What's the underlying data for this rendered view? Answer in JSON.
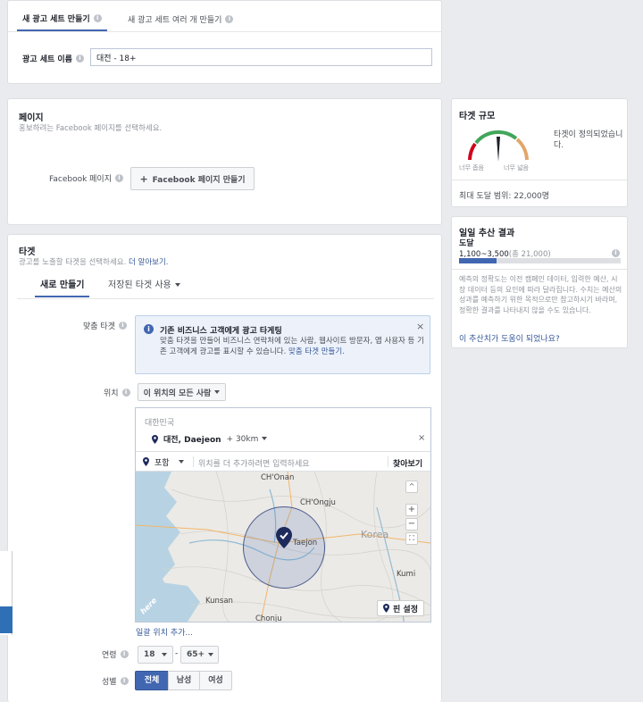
{
  "top_tabs": {
    "single": "새 광고 세트 만들기",
    "multiple": "새 광고 세트 여러 개 만들기"
  },
  "adset_name": {
    "label": "광고 세트 이름",
    "value": "대전 - 18+"
  },
  "page_section": {
    "title": "페이지",
    "subtitle": "홍보하려는 Facebook 페이지를 선택하세요.",
    "fb_label": "Facebook 페이지",
    "create_button": "Facebook 페이지 만들기"
  },
  "audience_size": {
    "title": "타겟 규모",
    "status": "타겟이 정의되었습니다.",
    "too_narrow": "너무 좁음",
    "too_broad": "너무 넓음",
    "max_reach": "최대 도달 범위: 22,000명"
  },
  "daily_results": {
    "title": "일일 추산 결과",
    "metric": "도달",
    "range": "1,100~3,500",
    "total": "(총 21,000)",
    "fill": 0.23,
    "description": "예측의 정확도는 이전 캠페인 데이터, 입력한 예산, 시장 데이터 등의 요인에 따라 달라집니다. 수치는 예산의 성과를 예측하기 위한 목적으로만 참고하시기 바라며, 정확한 결과를 나타내지 않을 수도 있습니다.",
    "feedback_link": "이 추산치가 도움이 되었나요?"
  },
  "targeting": {
    "title": "타겟",
    "subtitle": "광고를 노출할 타겟을 선택하세요.",
    "learn_more": "더 알아보기.",
    "tab_new": "새로 만들기",
    "tab_saved": "저장된 타겟 사용",
    "custom_label": "맞춤 타겟",
    "info_title": "기존 비즈니스 고객에게 광고 타게팅",
    "info_body": "맞춤 타겟을 만들어 비즈니스 연락처에 있는 사람, 웹사이트 방문자, 앱 사용자 등 기존 고객에게 광고를 표시할 수 있습니다.",
    "info_link": "맞춤 타겟 만들기.",
    "location_label": "위치",
    "location_type": "이 위치의 모든 사람",
    "country": "대한민국",
    "city": "대전, Daejeon",
    "radius": "+ 30km",
    "include": "포함",
    "search_placeholder": "위치를 더 추가하려면 입력하세요",
    "browse": "찾아보기",
    "add_bulk": "일괄 위치 추가...",
    "pin_button": "핀 설정",
    "age_label": "연령",
    "age_min": "18",
    "age_max": "65+",
    "age_sep": "-",
    "gender_label": "성별",
    "gender_all": "전체",
    "gender_male": "남성",
    "gender_female": "여성"
  },
  "map": {
    "labels": {
      "chonan": "CH'Onan",
      "chongju": "CH'Ongju",
      "taejon": "Taejon",
      "korea": "Korea",
      "kumi": "Kumi",
      "kunsan": "Kunsan",
      "chonju": "Chonju",
      "here": "here"
    },
    "zoom_in": "+",
    "zoom_out": "−"
  }
}
